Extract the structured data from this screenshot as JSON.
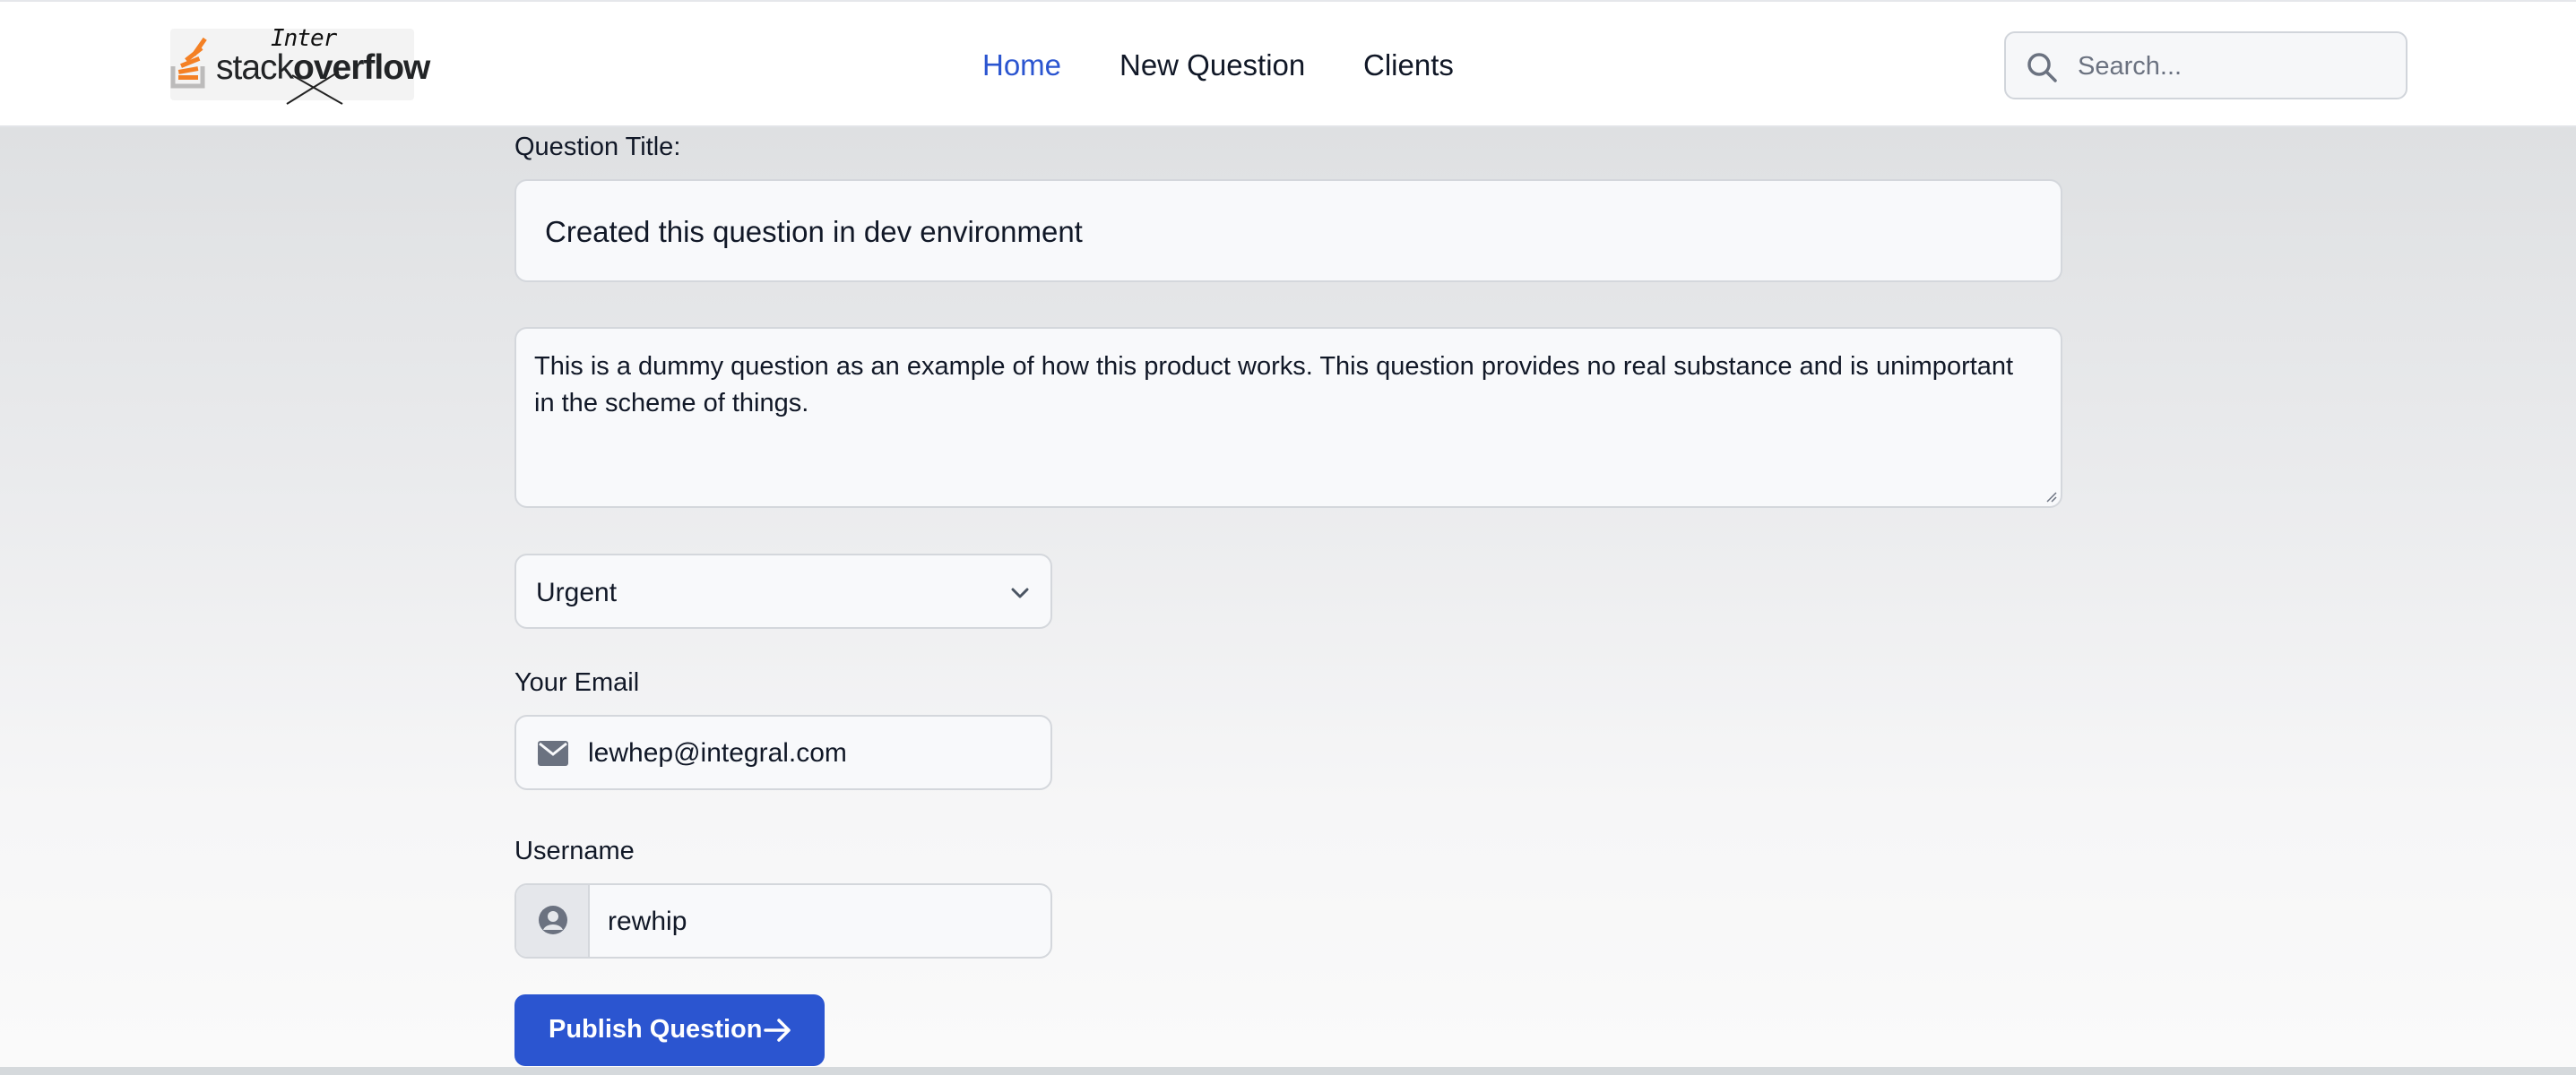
{
  "header": {
    "logo": {
      "word_stack": "stack",
      "word_overflow": "overflow",
      "scribble": "Inter"
    },
    "nav": [
      {
        "label": "Home",
        "active": true
      },
      {
        "label": "New Question",
        "active": false
      },
      {
        "label": "Clients",
        "active": false
      }
    ],
    "search": {
      "placeholder": "Search...",
      "icon": "search-icon"
    }
  },
  "form": {
    "title_label": "Question Title:",
    "title_value": "Created this question in dev environment",
    "body_value": "This is a dummy question as an example of how this product works. This question provides no real substance and is unimportant in the scheme of things.",
    "priority": {
      "selected": "Urgent",
      "icon": "chevron-down-icon"
    },
    "email": {
      "label": "Your Email",
      "value": "lewhep@integral.com",
      "icon": "mail-icon"
    },
    "username": {
      "label": "Username",
      "value": "rewhip",
      "icon": "user-icon"
    },
    "submit": {
      "label": "Publish Question",
      "icon": "arrow-right-icon"
    }
  },
  "colors": {
    "accent": "#2b55d0",
    "logo_orange": "#f48024",
    "logo_gray": "#bcbbbb"
  }
}
